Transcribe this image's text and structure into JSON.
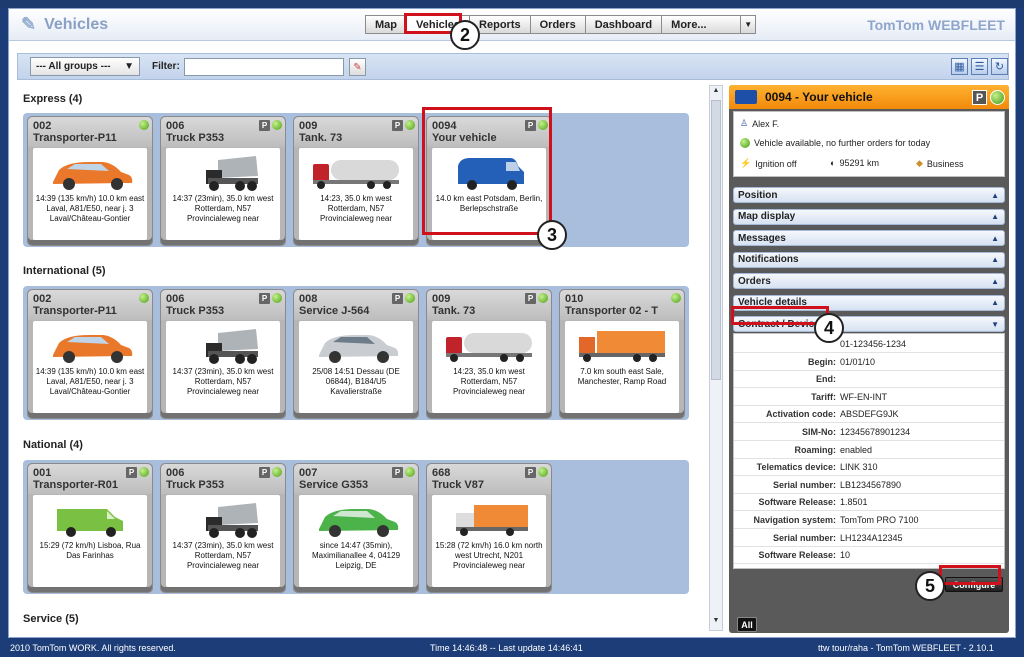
{
  "app": {
    "title": "Vehicles",
    "brand": "TomTom WEBFLEET"
  },
  "nav": {
    "tabs": [
      "Map",
      "Vehicles",
      "Reports",
      "Orders",
      "Dashboard"
    ],
    "more": "More..."
  },
  "filter": {
    "group": "--- All groups ---",
    "label": "Filter:",
    "value": ""
  },
  "groups": [
    {
      "title": "Express (4)",
      "cards": [
        {
          "num": "002",
          "name": "Transporter-P11",
          "p": false,
          "loc": "14:39 (135 km/h) 10.0 km east Laval, A81/E50, near j. 3 Laval/Château-Gontier",
          "pic": "car-orange"
        },
        {
          "num": "006",
          "name": "Truck P353",
          "p": true,
          "loc": "14:37 (23min), 35.0 km west Rotterdam, N57 Provincialeweg near",
          "pic": "dump-truck"
        },
        {
          "num": "009",
          "name": "Tank. 73",
          "p": true,
          "loc": "14:23, 35.0 km west Rotterdam, N57 Provincialeweg near",
          "pic": "tanker"
        },
        {
          "num": "0094",
          "name": "Your vehicle",
          "p": true,
          "loc": "14.0 km east Potsdam, Berlin, Berlepschstraße",
          "pic": "van-blue"
        }
      ]
    },
    {
      "title": "International (5)",
      "cards": [
        {
          "num": "002",
          "name": "Transporter-P11",
          "p": false,
          "loc": "14:39 (135 km/h) 10.0 km east Laval, A81/E50, near j. 3 Laval/Château-Gontier",
          "pic": "car-orange"
        },
        {
          "num": "006",
          "name": "Truck P353",
          "p": true,
          "loc": "14:37 (23min), 35.0 km west Rotterdam, N57 Provincialeweg near",
          "pic": "dump-truck"
        },
        {
          "num": "008",
          "name": "Service J-564",
          "p": true,
          "loc": "25/08 14:51 Dessau (DE 06844), B184/U5 Kavalierstraße",
          "pic": "car-silver"
        },
        {
          "num": "009",
          "name": "Tank. 73",
          "p": true,
          "loc": "14:23, 35.0 km west Rotterdam, N57 Provincialeweg near",
          "pic": "tanker"
        },
        {
          "num": "010",
          "name": "Transporter 02 - T",
          "p": false,
          "loc": "7.0 km south east Sale, Manchester, Ramp Road",
          "pic": "truck-orange"
        }
      ]
    },
    {
      "title": "National (4)",
      "cards": [
        {
          "num": "001",
          "name": "Transporter-R01",
          "p": true,
          "loc": "15:29 (72 km/h) Lisboa, Rua Das Farinhas",
          "pic": "van-green"
        },
        {
          "num": "006",
          "name": "Truck P353",
          "p": true,
          "loc": "14:37 (23min), 35.0 km west Rotterdam, N57 Provincialeweg near",
          "pic": "dump-truck"
        },
        {
          "num": "007",
          "name": "Service G353",
          "p": true,
          "loc": "since 14:47 (35min), Maximilianallee 4, 04129 Leipzig, DE",
          "pic": "car-green"
        },
        {
          "num": "668",
          "name": "Truck V87",
          "p": true,
          "loc": "15:28 (72 km/h) 16.0 km north west Utrecht, N201 Provincialeweg near",
          "pic": "box-truck"
        }
      ]
    },
    {
      "title": "Service (5)",
      "cards": []
    }
  ],
  "detail": {
    "title": "0094 -  Your vehicle",
    "driver": "Alex F.",
    "status": "Vehicle available, no further orders for today",
    "ignition": "Ignition off",
    "odometer": "95291 km",
    "usage": "Business",
    "sections": [
      "Position",
      "Map display",
      "Messages",
      "Notifications",
      "Orders",
      "Vehicle details",
      "Contract / Device"
    ],
    "contract": [
      {
        "k": "",
        "v": "01-123456-1234"
      },
      {
        "k": "Begin:",
        "v": "01/01/10"
      },
      {
        "k": "End:",
        "v": ""
      },
      {
        "k": "Tariff:",
        "v": "WF-EN-INT"
      },
      {
        "k": "Activation code:",
        "v": "ABSDEFG9JK"
      },
      {
        "k": "SIM-No:",
        "v": "12345678901234"
      },
      {
        "k": "Roaming:",
        "v": "enabled"
      },
      {
        "k": "Telematics device:",
        "v": "LINK 310"
      },
      {
        "k": "Serial number:",
        "v": "LB1234567890"
      },
      {
        "k": "Software Release:",
        "v": "1.8501"
      },
      {
        "k": "Navigation system:",
        "v": "TomTom PRO 7100"
      },
      {
        "k": "Serial number:",
        "v": "LH1234A12345"
      },
      {
        "k": "Software Release:",
        "v": "10"
      }
    ],
    "configure": "Configure",
    "all": "All"
  },
  "status": {
    "left": "2010 TomTom WORK. All rights reserved.",
    "mid": "Time 14:46:48 -- Last update 14:46:41",
    "right": "ttw tour/raha - TomTom WEBFLEET - 2.10.1"
  },
  "callouts": [
    "2",
    "3",
    "4",
    "5"
  ],
  "colors": {
    "accent": "#f2890a",
    "highlight": "#d0101a",
    "nav_bg": "#1d3d78",
    "status_ok": "#4aa012"
  }
}
